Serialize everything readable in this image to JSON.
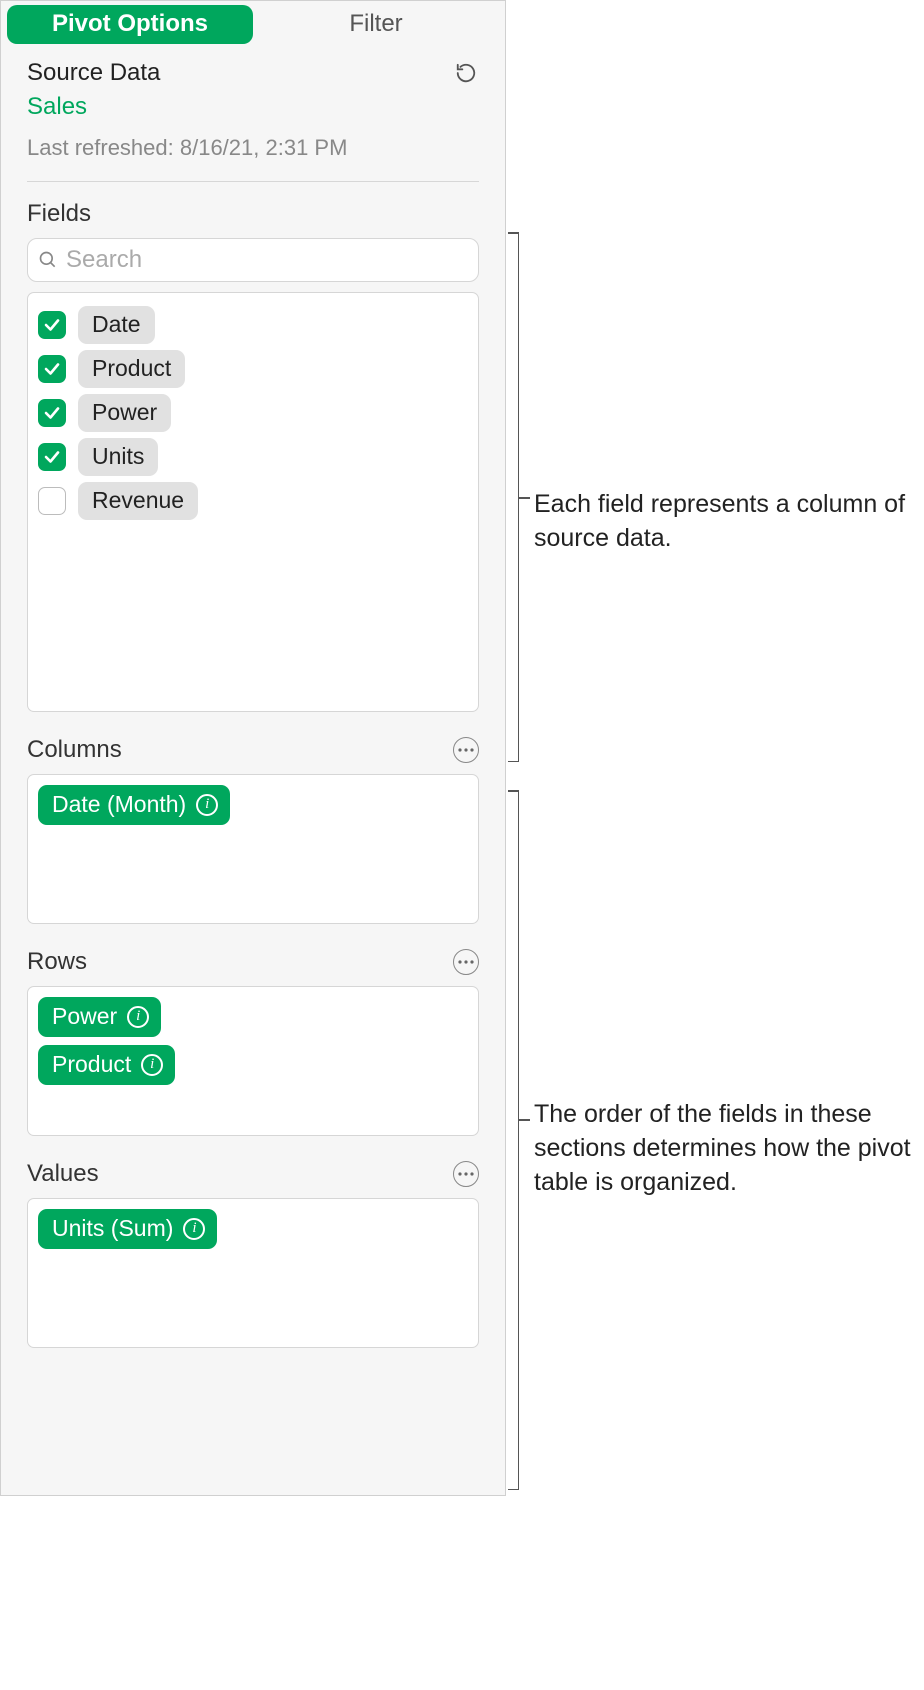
{
  "tabs": {
    "pivot_options": "Pivot Options",
    "filter": "Filter"
  },
  "source": {
    "title": "Source Data",
    "name": "Sales",
    "refreshed": "Last refreshed: 8/16/21, 2:31 PM"
  },
  "fields_section": {
    "title": "Fields",
    "search_placeholder": "Search",
    "items": [
      {
        "label": "Date",
        "checked": true
      },
      {
        "label": "Product",
        "checked": true
      },
      {
        "label": "Power",
        "checked": true
      },
      {
        "label": "Units",
        "checked": true
      },
      {
        "label": "Revenue",
        "checked": false
      }
    ]
  },
  "columns_section": {
    "title": "Columns",
    "items": [
      {
        "label": "Date (Month)"
      }
    ]
  },
  "rows_section": {
    "title": "Rows",
    "items": [
      {
        "label": "Power"
      },
      {
        "label": "Product"
      }
    ]
  },
  "values_section": {
    "title": "Values",
    "items": [
      {
        "label": "Units (Sum)"
      }
    ]
  },
  "callouts": {
    "fields": "Each field represents a column of source data.",
    "zones": "The order of the fields in these sections determines how the pivot table is organized."
  }
}
